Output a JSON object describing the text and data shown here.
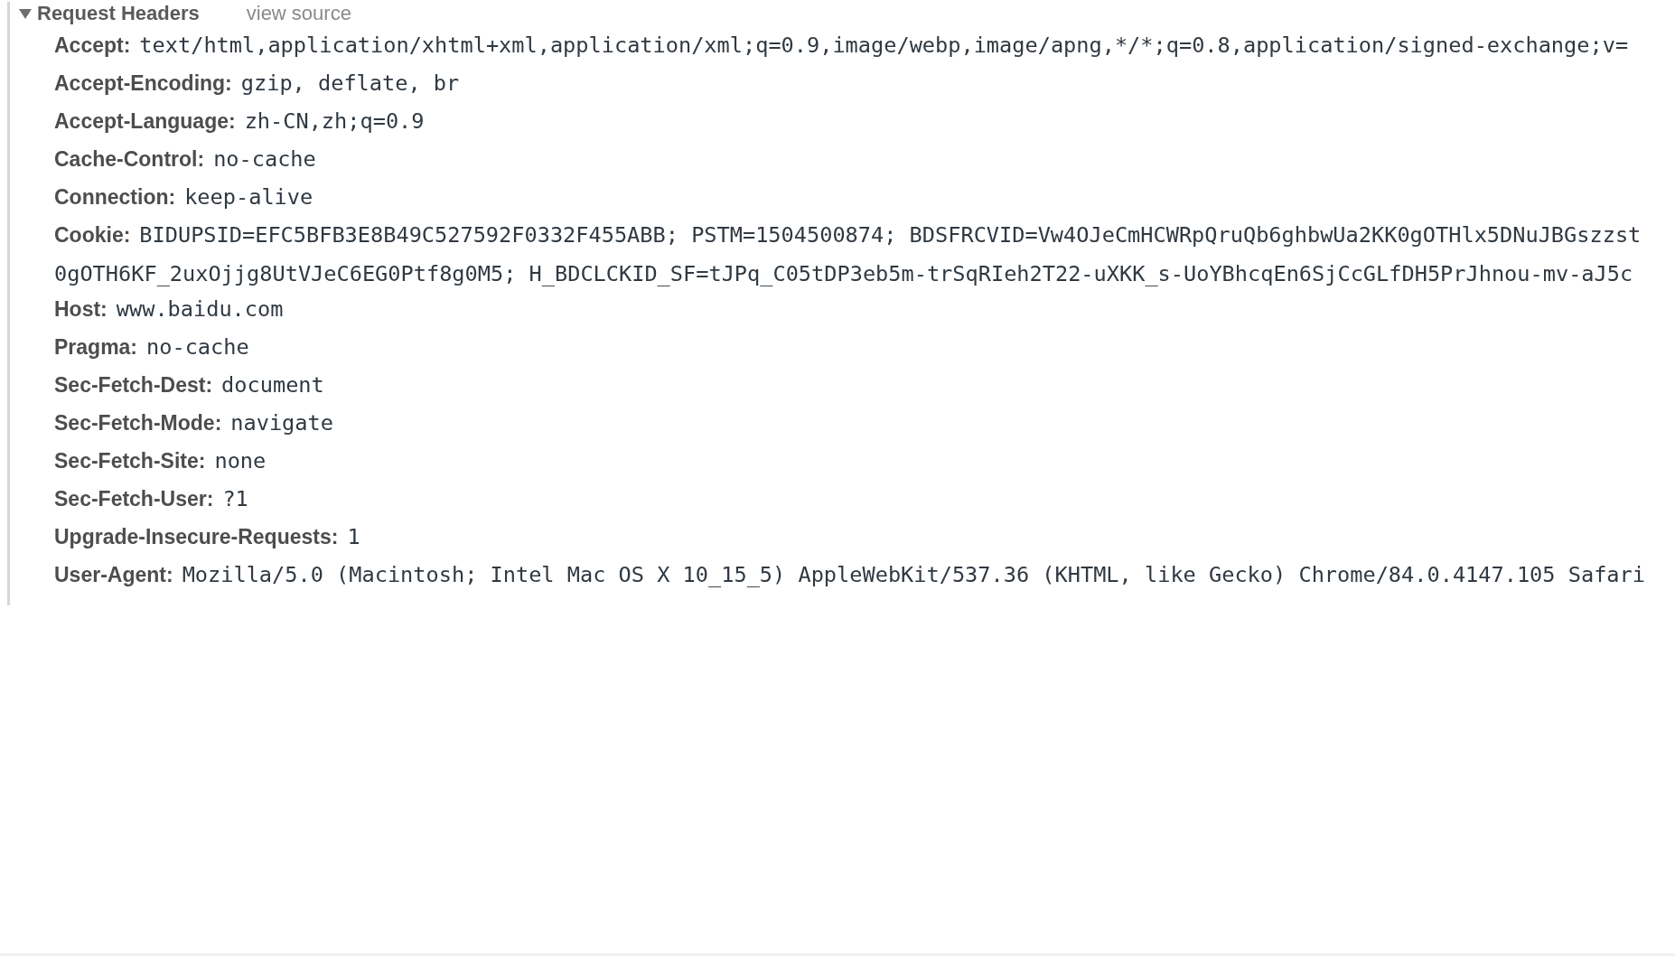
{
  "section": {
    "title": "Request Headers",
    "expanded": true,
    "link": "view source"
  },
  "headers": [
    {
      "name": "Accept:",
      "value_lines": [
        "text/html,application/xhtml+xml,application/xml;q=0.9,image/webp,image/apng,*/*;q=0.8,application/signed-exchange;v="
      ]
    },
    {
      "name": "Accept-Encoding:",
      "value_lines": [
        "gzip, deflate, br"
      ]
    },
    {
      "name": "Accept-Language:",
      "value_lines": [
        "zh-CN,zh;q=0.9"
      ]
    },
    {
      "name": "Cache-Control:",
      "value_lines": [
        "no-cache"
      ]
    },
    {
      "name": "Connection:",
      "value_lines": [
        "keep-alive"
      ]
    },
    {
      "name": "Cookie:",
      "value_lines": [
        "BIDUPSID=EFC5BFB3E8B49C527592F0332F455ABB; PSTM=1504500874; BDSFRCVID=Vw4OJeCmHCWRpQruQb6ghbwUa2KK0gOTHlx5DNuJBGszzst",
        "0gOTH6KF_2uxOjjg8UtVJeC6EG0Ptf8g0M5; H_BDCLCKID_SF=tJPq_C05tDP3eb5m-trSqRIeh2T22-uXKK_s-UoYBhcqEn6SjCcGLfDH5PrJhnou-mv-aJ5c"
      ]
    },
    {
      "name": "Host:",
      "value_lines": [
        "www.baidu.com"
      ]
    },
    {
      "name": "Pragma:",
      "value_lines": [
        "no-cache"
      ]
    },
    {
      "name": "Sec-Fetch-Dest:",
      "value_lines": [
        "document"
      ]
    },
    {
      "name": "Sec-Fetch-Mode:",
      "value_lines": [
        "navigate"
      ]
    },
    {
      "name": "Sec-Fetch-Site:",
      "value_lines": [
        "none"
      ]
    },
    {
      "name": "Sec-Fetch-User:",
      "value_lines": [
        "?1"
      ]
    },
    {
      "name": "Upgrade-Insecure-Requests:",
      "value_lines": [
        "1"
      ]
    },
    {
      "name": "User-Agent:",
      "value_lines": [
        "Mozilla/5.0 (Macintosh; Intel Mac OS X 10_15_5) AppleWebKit/537.36 (KHTML, like Gecko) Chrome/84.0.4147.105 Safari"
      ]
    }
  ]
}
